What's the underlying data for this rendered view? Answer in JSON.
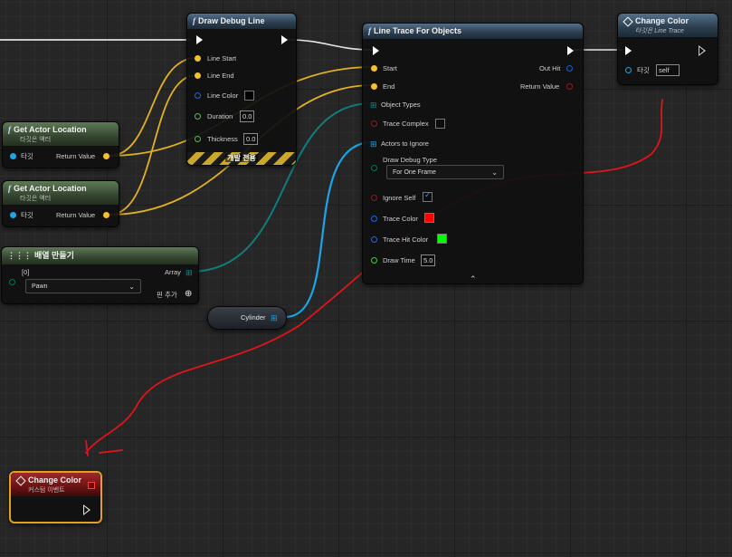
{
  "nodes": {
    "draw_debug_line": {
      "title": "Draw Debug Line",
      "pins": {
        "line_start": "Line Start",
        "line_end": "Line End",
        "line_color": "Line Color",
        "duration": "Duration",
        "thickness": "Thickness"
      },
      "duration_value": "0.0",
      "thickness_value": "0.0",
      "dev_only": "개발 전용"
    },
    "line_trace": {
      "title": "Line Trace For Objects",
      "pins": {
        "start": "Start",
        "end": "End",
        "object_types": "Object Types",
        "trace_complex": "Trace Complex",
        "actors_to_ignore": "Actors to Ignore",
        "draw_debug_type": "Draw Debug Type",
        "ignore_self": "Ignore Self",
        "trace_color": "Trace Color",
        "trace_hit_color": "Trace Hit Color",
        "draw_time": "Draw Time",
        "out_hit": "Out Hit",
        "return_value": "Return Value"
      },
      "draw_debug_type_value": "For One Frame",
      "draw_time_value": "5.0",
      "expand": "⌃"
    },
    "change_color_call": {
      "title": "Change Color",
      "subtitle": "타깃은 Line Trace",
      "target_label": "타깃",
      "target_value": "self"
    },
    "get_actor_location_1": {
      "title": "Get Actor Location",
      "subtitle": "타깃은 액터",
      "target": "타깃",
      "return_value": "Return Value"
    },
    "get_actor_location_2": {
      "title": "Get Actor Location",
      "subtitle": "타깃은 액터",
      "target": "타깃",
      "return_value": "Return Value"
    },
    "make_array": {
      "title": "배열 만들기",
      "index": "[0]",
      "item_value": "Pawn",
      "array": "Array",
      "add_pin": "핀 추가"
    },
    "cylinder": {
      "label": "Cylinder"
    },
    "custom_event": {
      "title": "Change Color",
      "subtitle": "커스텀 이벤트"
    }
  },
  "colors": {
    "exec": "#ffffff",
    "vector": "#f5c02a",
    "object": "#1aa6e8",
    "array_obj": "#138a8a",
    "bool": "#8e1a1a",
    "float": "#48c24a",
    "linear_color": "#1d6ae0",
    "struct": "#1f5fbf",
    "trace_color": "#ff0000",
    "trace_hit_color": "#00ff00",
    "annotation": "#e0141a"
  },
  "icons": [
    "function-icon",
    "event-diamond-icon",
    "exec-pin-icon",
    "array-grid-icon",
    "chevron-down-icon",
    "add-pin-icon",
    "checkbox-check-icon"
  ]
}
